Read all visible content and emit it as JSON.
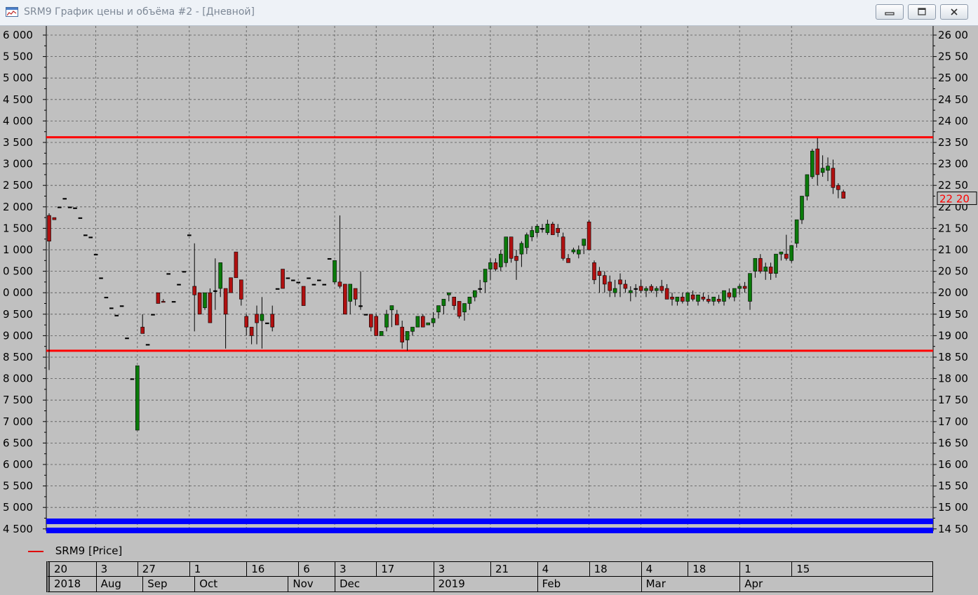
{
  "window": {
    "title": "SRM9 График цены и объёма #2 - [Дневной]",
    "icon": "chart-window-icon",
    "controls": [
      "minimize-icon",
      "maximize-icon",
      "close-icon"
    ]
  },
  "legend": {
    "label": "SRM9 [Price]",
    "color": "#e00000"
  },
  "colors": {
    "background": "#c0c0c0",
    "up_candle": "#0a7a0a",
    "down_candle": "#b01010",
    "level_lines": "#ff0000",
    "volume_band": "#0000ff",
    "price_marker": "#ff0000"
  },
  "chart_data": {
    "type": "candlestick",
    "symbol": "SRM9",
    "left_axis": {
      "min": 14500,
      "max": 26000,
      "step": 500,
      "ticks": [
        "6 000",
        "5 500",
        "5 000",
        "4 500",
        "4 000",
        "3 500",
        "3 000",
        "2 500",
        "2 000",
        "1 500",
        "1 000",
        "0 500",
        "0 000",
        "9 500",
        "9 000",
        "8 500",
        "8 000",
        "7 500",
        "7 000",
        "6 500",
        "6 000",
        "5 500",
        "5 000",
        "4 500"
      ]
    },
    "right_axis": {
      "min": 14500,
      "max": 26000,
      "step": 500,
      "ticks": [
        "26 00",
        "25 50",
        "25 00",
        "24 50",
        "24 00",
        "23 50",
        "23 00",
        "22 50",
        "22 00",
        "21 50",
        "21 00",
        "20 50",
        "20 00",
        "19 50",
        "19 00",
        "18 50",
        "18 00",
        "17 50",
        "17 00",
        "16 50",
        "16 00",
        "15 50",
        "15 00",
        "14 50"
      ]
    },
    "last_price": {
      "value": 22200,
      "label": "22 20"
    },
    "horizontal_lines": [
      {
        "value": 23620,
        "color": "#ff0000"
      },
      {
        "value": 18650,
        "color": "#ff0000"
      }
    ],
    "volume_band": {
      "color": "#0000ff"
    },
    "grid": true,
    "day_labels": [
      {
        "label": "20",
        "i": 0
      },
      {
        "label": "3",
        "i": 9
      },
      {
        "label": "27",
        "i": 17
      },
      {
        "label": "1",
        "i": 27
      },
      {
        "label": "16",
        "i": 38
      },
      {
        "label": "6",
        "i": 48
      },
      {
        "label": "3",
        "i": 55
      },
      {
        "label": "17",
        "i": 63
      },
      {
        "label": "3",
        "i": 74
      },
      {
        "label": "21",
        "i": 85
      },
      {
        "label": "4",
        "i": 94
      },
      {
        "label": "18",
        "i": 104
      },
      {
        "label": "4",
        "i": 114
      },
      {
        "label": "18",
        "i": 123
      },
      {
        "label": "1",
        "i": 133
      },
      {
        "label": "15",
        "i": 143
      }
    ],
    "month_labels": [
      {
        "label": "2018",
        "i": 0
      },
      {
        "label": "Aug",
        "i": 9
      },
      {
        "label": "Sep",
        "i": 18
      },
      {
        "label": "Oct",
        "i": 28
      },
      {
        "label": "Nov",
        "i": 46
      },
      {
        "label": "Dec",
        "i": 55
      },
      {
        "label": "2019",
        "i": 74
      },
      {
        "label": "Feb",
        "i": 94
      },
      {
        "label": "Mar",
        "i": 114
      },
      {
        "label": "Apr",
        "i": 133
      }
    ],
    "candles": [
      [
        21800,
        21850,
        18200,
        21200
      ],
      [
        21750,
        21750,
        21700,
        21700
      ],
      [
        22000,
        22000,
        22000,
        22000
      ],
      [
        22200,
        22200,
        22200,
        22200
      ],
      [
        22000,
        22000,
        22000,
        22000
      ],
      [
        21980,
        21980,
        21980,
        21980
      ],
      [
        21750,
        21750,
        21750,
        21750
      ],
      [
        21350,
        21350,
        21350,
        21350
      ],
      [
        21300,
        21300,
        21300,
        21300
      ],
      [
        20900,
        20900,
        20900,
        20900
      ],
      [
        20350,
        20350,
        20350,
        20350
      ],
      [
        19900,
        19900,
        19900,
        19900
      ],
      [
        19650,
        19650,
        19650,
        19650
      ],
      [
        19480,
        19480,
        19480,
        19480
      ],
      [
        19700,
        19700,
        19700,
        19700
      ],
      [
        18950,
        18950,
        18950,
        18950
      ],
      [
        18000,
        18000,
        18000,
        18000
      ],
      [
        16800,
        18300,
        16800,
        18300
      ],
      [
        19200,
        19500,
        19100,
        19050
      ],
      [
        18800,
        18800,
        18800,
        18800
      ],
      [
        19500,
        19500,
        19500,
        19500
      ],
      [
        20000,
        20000,
        20000,
        19750
      ],
      [
        19800,
        19850,
        19800,
        19780
      ],
      [
        20450,
        20450,
        20450,
        20450
      ],
      [
        19800,
        19800,
        19800,
        19800
      ],
      [
        20200,
        20200,
        20200,
        20200
      ],
      [
        20500,
        20500,
        20500,
        20500
      ],
      [
        21350,
        21350,
        21350,
        21350
      ],
      [
        20150,
        21150,
        19100,
        19950
      ],
      [
        20000,
        20000,
        19500,
        19500
      ],
      [
        19650,
        19900,
        19600,
        20000
      ],
      [
        20000,
        20100,
        19300,
        19300
      ],
      [
        20050,
        20800,
        19600,
        20050
      ],
      [
        20100,
        20700,
        19900,
        20700
      ],
      [
        20100,
        20100,
        18700,
        19500
      ],
      [
        20350,
        20350,
        20350,
        20000
      ],
      [
        20950,
        20950,
        20950,
        20350
      ],
      [
        20300,
        20300,
        19700,
        19850
      ],
      [
        19450,
        19500,
        19000,
        19200
      ],
      [
        19200,
        19200,
        18800,
        19000
      ],
      [
        19500,
        19700,
        18800,
        19300
      ],
      [
        19350,
        19900,
        18700,
        19500
      ],
      [
        19300,
        19300,
        19300,
        19300
      ],
      [
        19500,
        19700,
        19100,
        19200
      ],
      [
        20100,
        20100,
        20100,
        20100
      ],
      [
        20550,
        20550,
        20550,
        20100
      ],
      [
        20350,
        20350,
        20350,
        20350
      ],
      [
        20300,
        20300,
        20300,
        20300
      ],
      [
        20250,
        20250,
        20250,
        20250
      ],
      [
        20150,
        20150,
        19700,
        19700
      ],
      [
        20350,
        20350,
        20350,
        20350
      ],
      [
        20200,
        20200,
        20200,
        20200
      ],
      [
        20300,
        20300,
        20300,
        20300
      ],
      [
        20200,
        20200,
        20200,
        20200
      ],
      [
        20800,
        20800,
        20800,
        20800
      ],
      [
        20250,
        20750,
        20200,
        20750
      ],
      [
        20250,
        21800,
        20100,
        20150
      ],
      [
        20200,
        20200,
        19500,
        19500
      ],
      [
        19800,
        20150,
        19500,
        20200
      ],
      [
        20100,
        20100,
        19700,
        19850
      ],
      [
        19700,
        20500,
        19600,
        19700
      ],
      [
        19500,
        19500,
        19500,
        19500
      ],
      [
        19500,
        19500,
        19100,
        19200
      ],
      [
        19450,
        19500,
        19050,
        19000
      ],
      [
        19000,
        19100,
        19000,
        19100
      ],
      [
        19200,
        19600,
        19100,
        19500
      ],
      [
        19600,
        19700,
        19200,
        19700
      ],
      [
        19500,
        19600,
        19250,
        19250
      ],
      [
        19200,
        19350,
        18700,
        18850
      ],
      [
        18900,
        18900,
        18650,
        19100
      ],
      [
        19100,
        19200,
        19000,
        19200
      ],
      [
        19200,
        19400,
        19200,
        19450
      ],
      [
        19450,
        19500,
        19200,
        19200
      ],
      [
        19250,
        19250,
        19250,
        19300
      ],
      [
        19300,
        19550,
        19200,
        19400
      ],
      [
        19550,
        19700,
        19400,
        19700
      ],
      [
        19700,
        19800,
        19500,
        19850
      ],
      [
        19950,
        20000,
        19800,
        20000
      ],
      [
        19900,
        19900,
        19600,
        19700
      ],
      [
        19800,
        19800,
        19400,
        19450
      ],
      [
        19550,
        19700,
        19350,
        19750
      ],
      [
        19750,
        19900,
        19600,
        19900
      ],
      [
        19900,
        20000,
        19800,
        20050
      ],
      [
        20100,
        20300,
        20000,
        20100
      ],
      [
        20250,
        20300,
        20000,
        20550
      ],
      [
        20550,
        20800,
        20300,
        20700
      ],
      [
        20700,
        20800,
        20500,
        20550
      ],
      [
        20600,
        21000,
        20500,
        20900
      ],
      [
        20700,
        21300,
        20600,
        21300
      ],
      [
        21300,
        21300,
        20700,
        20800
      ],
      [
        20850,
        21000,
        20300,
        20750
      ],
      [
        20900,
        21200,
        20600,
        21150
      ],
      [
        21050,
        21400,
        20900,
        21350
      ],
      [
        21300,
        21550,
        21200,
        21450
      ],
      [
        21400,
        21600,
        21300,
        21550
      ],
      [
        21500,
        21600,
        21400,
        21500
      ],
      [
        21400,
        21700,
        21350,
        21600
      ],
      [
        21600,
        21650,
        21350,
        21350
      ],
      [
        21500,
        21600,
        21300,
        21400
      ],
      [
        21300,
        21400,
        20750,
        20800
      ],
      [
        20800,
        20900,
        20700,
        20700
      ],
      [
        20950,
        21050,
        20900,
        21000
      ],
      [
        20900,
        21100,
        20800,
        21000
      ],
      [
        21100,
        21200,
        20900,
        21250
      ],
      [
        21650,
        21700,
        21000,
        21000
      ],
      [
        20700,
        20750,
        20200,
        20300
      ],
      [
        20500,
        20600,
        20000,
        20400
      ],
      [
        20400,
        20500,
        20000,
        20200
      ],
      [
        20250,
        20400,
        19900,
        20050
      ],
      [
        20000,
        20300,
        19900,
        20100
      ],
      [
        20300,
        20450,
        19900,
        20200
      ],
      [
        20200,
        20300,
        20000,
        20100
      ],
      [
        20000,
        20150,
        19800,
        20050
      ],
      [
        20100,
        20200,
        19900,
        20100
      ],
      [
        20150,
        20300,
        20000,
        20050
      ],
      [
        20050,
        20150,
        19900,
        20100
      ],
      [
        20150,
        20200,
        20000,
        20050
      ],
      [
        20050,
        20150,
        19900,
        20100
      ],
      [
        20150,
        20300,
        20000,
        20050
      ],
      [
        20100,
        20200,
        19950,
        19850
      ],
      [
        19900,
        20000,
        19700,
        19850
      ],
      [
        19800,
        19900,
        19700,
        19900
      ],
      [
        19900,
        20000,
        19750,
        19800
      ],
      [
        19800,
        19900,
        19700,
        20000
      ],
      [
        19950,
        20050,
        19800,
        19850
      ],
      [
        19800,
        19900,
        19700,
        19950
      ],
      [
        19900,
        20000,
        19800,
        19850
      ],
      [
        19850,
        19950,
        19750,
        19800
      ],
      [
        19800,
        19900,
        19700,
        19900
      ],
      [
        19850,
        19950,
        19750,
        19800
      ],
      [
        19800,
        19900,
        19700,
        20050
      ],
      [
        20000,
        20100,
        19850,
        19900
      ],
      [
        19900,
        20050,
        19800,
        20100
      ],
      [
        20100,
        20200,
        19950,
        20150
      ],
      [
        20150,
        20250,
        20000,
        20100
      ],
      [
        19800,
        20100,
        19600,
        20450
      ],
      [
        20500,
        20800,
        20350,
        20800
      ],
      [
        20800,
        20900,
        20450,
        20500
      ],
      [
        20500,
        20700,
        20300,
        20600
      ],
      [
        20600,
        20700,
        20300,
        20450
      ],
      [
        20450,
        20900,
        20350,
        20900
      ],
      [
        20900,
        20950,
        20750,
        20950
      ],
      [
        20900,
        21350,
        20750,
        20800
      ],
      [
        20750,
        21100,
        20700,
        21100
      ],
      [
        21150,
        21700,
        21050,
        21700
      ],
      [
        21700,
        22250,
        21600,
        22250
      ],
      [
        22250,
        22750,
        22150,
        22750
      ],
      [
        22700,
        23350,
        22650,
        23300
      ],
      [
        23350,
        23600,
        22500,
        22750
      ],
      [
        22800,
        23200,
        22700,
        22900
      ],
      [
        22850,
        23150,
        22600,
        22950
      ],
      [
        22900,
        23100,
        22300,
        22450
      ],
      [
        22500,
        22550,
        22200,
        22400
      ],
      [
        22350,
        22400,
        22200,
        22200
      ]
    ]
  }
}
